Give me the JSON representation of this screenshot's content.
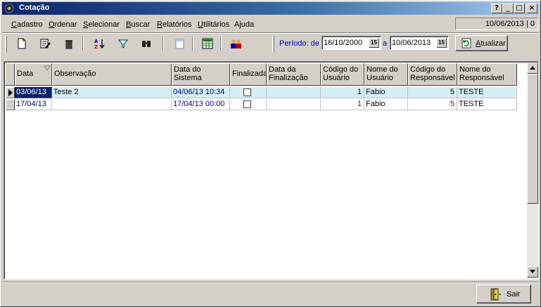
{
  "window": {
    "title": "Cotação",
    "status_date": "10/06/2013 | 0"
  },
  "menu": [
    {
      "u": "C",
      "rest": "adastro"
    },
    {
      "u": "O",
      "rest": "rdenar"
    },
    {
      "u": "S",
      "rest": "elecionar"
    },
    {
      "u": "B",
      "rest": "uscar"
    },
    {
      "u": "R",
      "rest": "elatórios"
    },
    {
      "u": "U",
      "rest": "tilitários"
    },
    {
      "u": "",
      "rest": "Ajuda"
    }
  ],
  "toolbar": {
    "icons": [
      "new-record-icon",
      "edit-record-icon",
      "delete-icon",
      "sort-az-icon",
      "filter-icon",
      "search-binoculars-icon",
      "page-icon",
      "spreadsheet-icon",
      "users-icon"
    ],
    "periodo_label": "Período: de",
    "date_from": "16/10/2000",
    "to_label": "a",
    "date_to": "10/06/2013",
    "calendar_glyph": "15",
    "refresh_label_u": "A",
    "refresh_label_rest": "tualizar"
  },
  "grid": {
    "columns": [
      "Data",
      "Observação",
      "Data do Sistema",
      "Finalizada",
      "Data da Finalização",
      "Código do Usuário",
      "Nome do Usuário",
      "Código do Responsável",
      "Nome do Responsável"
    ],
    "rows": [
      {
        "data": "03/06/13",
        "observacao": "Teste 2",
        "data_sistema": "04/06/13 10:34",
        "finalizada": false,
        "data_finalizacao": "",
        "codigo_usuario": "1",
        "nome_usuario": "Fabio",
        "codigo_responsavel": "5",
        "nome_responsavel": "TESTE"
      },
      {
        "data": "17/04/13",
        "observacao": "",
        "data_sistema": "17/04/13 00:00",
        "finalizada": false,
        "data_finalizacao": "",
        "codigo_usuario": "1",
        "nome_usuario": "Fabio",
        "codigo_responsavel": "5",
        "nome_responsavel": "TESTE"
      }
    ]
  },
  "footer": {
    "exit_label": "Sair"
  },
  "colors": {
    "title_start": "#0a246a",
    "title_end": "#a6caf0",
    "face": "#d4d0c8",
    "selected_row": "#d5eef5",
    "accent_blue": "#0000c0"
  }
}
